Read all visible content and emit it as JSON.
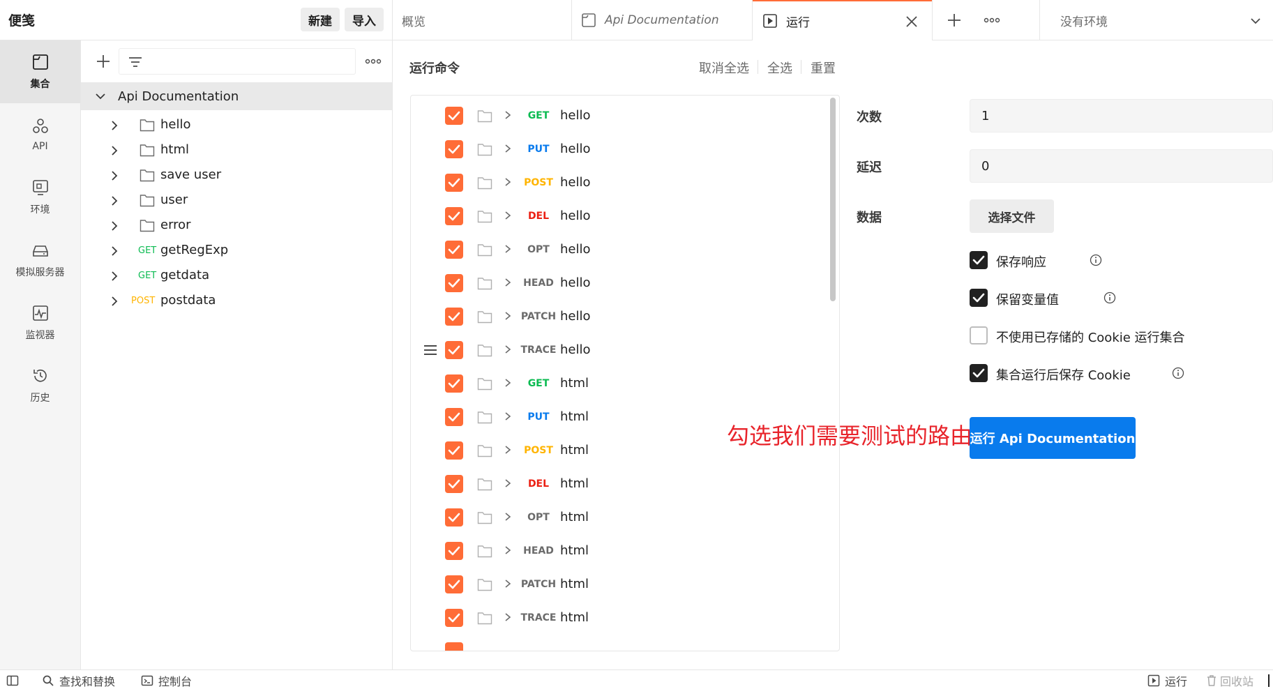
{
  "header": {
    "brand": "便笺",
    "new_label": "新建",
    "import_label": "导入",
    "tabs": [
      {
        "label": "概览"
      },
      {
        "label": "Api Documentation"
      },
      {
        "label": "运行"
      }
    ],
    "environment": "没有环境"
  },
  "rail": [
    {
      "label": "集合",
      "icon": "collection-icon",
      "active": true
    },
    {
      "label": "API",
      "icon": "api-icon"
    },
    {
      "label": "环境",
      "icon": "environment-icon"
    },
    {
      "label": "模拟服务器",
      "icon": "mock-server-icon"
    },
    {
      "label": "监视器",
      "icon": "monitor-icon"
    },
    {
      "label": "历史",
      "icon": "history-icon"
    }
  ],
  "sidebar": {
    "collection_name": "Api Documentation",
    "folders": [
      {
        "name": "hello"
      },
      {
        "name": "html"
      },
      {
        "name": "save user"
      },
      {
        "name": "user"
      },
      {
        "name": "error"
      }
    ],
    "requests": [
      {
        "method": "GET",
        "name": "getRegExp"
      },
      {
        "method": "GET",
        "name": "getdata"
      },
      {
        "method": "POST",
        "name": "postdata"
      }
    ]
  },
  "runner": {
    "title": "运行命令",
    "deselect_all": "取消全选",
    "select_all": "全选",
    "reset": "重置",
    "requests": [
      {
        "method": "GET",
        "name": "hello"
      },
      {
        "method": "PUT",
        "name": "hello"
      },
      {
        "method": "POST",
        "name": "hello"
      },
      {
        "method": "DEL",
        "name": "hello"
      },
      {
        "method": "OPT",
        "name": "hello"
      },
      {
        "method": "HEAD",
        "name": "hello"
      },
      {
        "method": "PATCH",
        "name": "hello"
      },
      {
        "method": "TRACE",
        "name": "hello"
      },
      {
        "method": "GET",
        "name": "html"
      },
      {
        "method": "PUT",
        "name": "html"
      },
      {
        "method": "POST",
        "name": "html"
      },
      {
        "method": "DEL",
        "name": "html"
      },
      {
        "method": "OPT",
        "name": "html"
      },
      {
        "method": "HEAD",
        "name": "html"
      },
      {
        "method": "PATCH",
        "name": "html"
      },
      {
        "method": "TRACE",
        "name": "html"
      }
    ]
  },
  "settings": {
    "iterations_label": "次数",
    "iterations_value": "1",
    "delay_label": "延迟",
    "delay_value": "0",
    "data_label": "数据",
    "file_button": "选择文件",
    "options": [
      {
        "label": "保存响应",
        "checked": true,
        "info": true
      },
      {
        "label": "保留变量值",
        "checked": true,
        "info": true
      },
      {
        "label": "不使用已存储的 Cookie 运行集合",
        "checked": false,
        "info": false
      },
      {
        "label": "集合运行后保存 Cookie",
        "checked": true,
        "info": true
      }
    ],
    "run_button": "运行 Api Documentation"
  },
  "annotation": "勾选我们需要测试的路由",
  "statusbar": {
    "find_replace": "查找和替换",
    "console": "控制台",
    "runner": "运行",
    "trash": "回收站"
  },
  "colors": {
    "accent": "#ff6c37",
    "run_button": "#097bed",
    "annotation": "#e8242b",
    "GET": "#0cbb52",
    "PUT": "#097bed",
    "POST": "#ffb400",
    "DEL": "#eb2013",
    "OPT": "#6b6b6b",
    "HEAD": "#6b6b6b",
    "PATCH": "#6b6b6b",
    "TRACE": "#6b6b6b"
  }
}
